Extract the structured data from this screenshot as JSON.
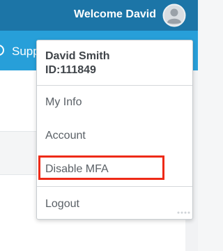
{
  "header": {
    "welcome_text": "Welcome David",
    "avatar_icon": "user-avatar-icon"
  },
  "nav": {
    "item_label": "Supp",
    "item_icon": "support-icon"
  },
  "user_menu": {
    "name": "David Smith",
    "id": "ID:111849",
    "items": [
      {
        "label": "My Info"
      },
      {
        "label": "Account"
      },
      {
        "label": "Disable MFA",
        "highlighted": true
      },
      {
        "label": "Logout"
      }
    ]
  },
  "colors": {
    "header_bg": "#1c75a7",
    "nav_bg": "#279fd9",
    "highlight": "#ee2a17"
  }
}
